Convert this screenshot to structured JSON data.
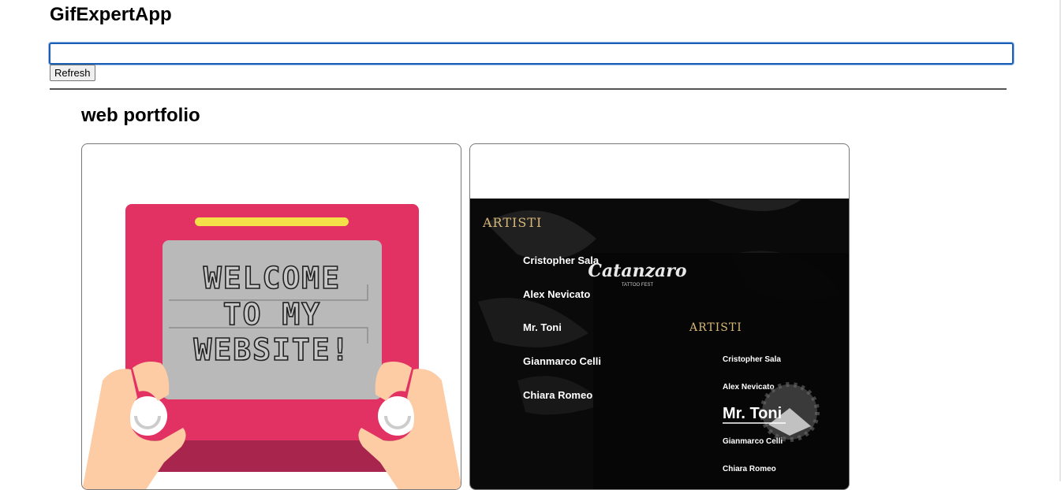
{
  "app": {
    "title": "GifExpertApp"
  },
  "search": {
    "value": "",
    "placeholder": ""
  },
  "toolbar": {
    "refresh_label": "Refresh"
  },
  "category": {
    "title": "web portfolio"
  },
  "gifs": [
    {
      "name": "welcome-etch-a-sketch-gif",
      "screen_lines": [
        "WELCOME",
        "TO MY",
        "WEBSITE!"
      ]
    },
    {
      "name": "tattoo-website-gif",
      "heading": "ARTISTI",
      "logo_text": "Catanzaro",
      "logo_subtext": "TATTOO FEST",
      "artists": [
        "Cristopher Sala",
        "Alex Nevicato",
        "Mr. Toni",
        "Gianmarco Celli",
        "Chiara Romeo"
      ],
      "artists_overlay": [
        "Cristopher Sala",
        "Alex Nevicato",
        "Mr. Toni",
        "Gianmarco Celli",
        "Chiara Romeo"
      ]
    }
  ],
  "colors": {
    "accent": "#1a5fb4",
    "sketch_red": "#e23263",
    "sketch_yellow": "#f4e14a",
    "tattoo_gold": "#d8b878"
  }
}
